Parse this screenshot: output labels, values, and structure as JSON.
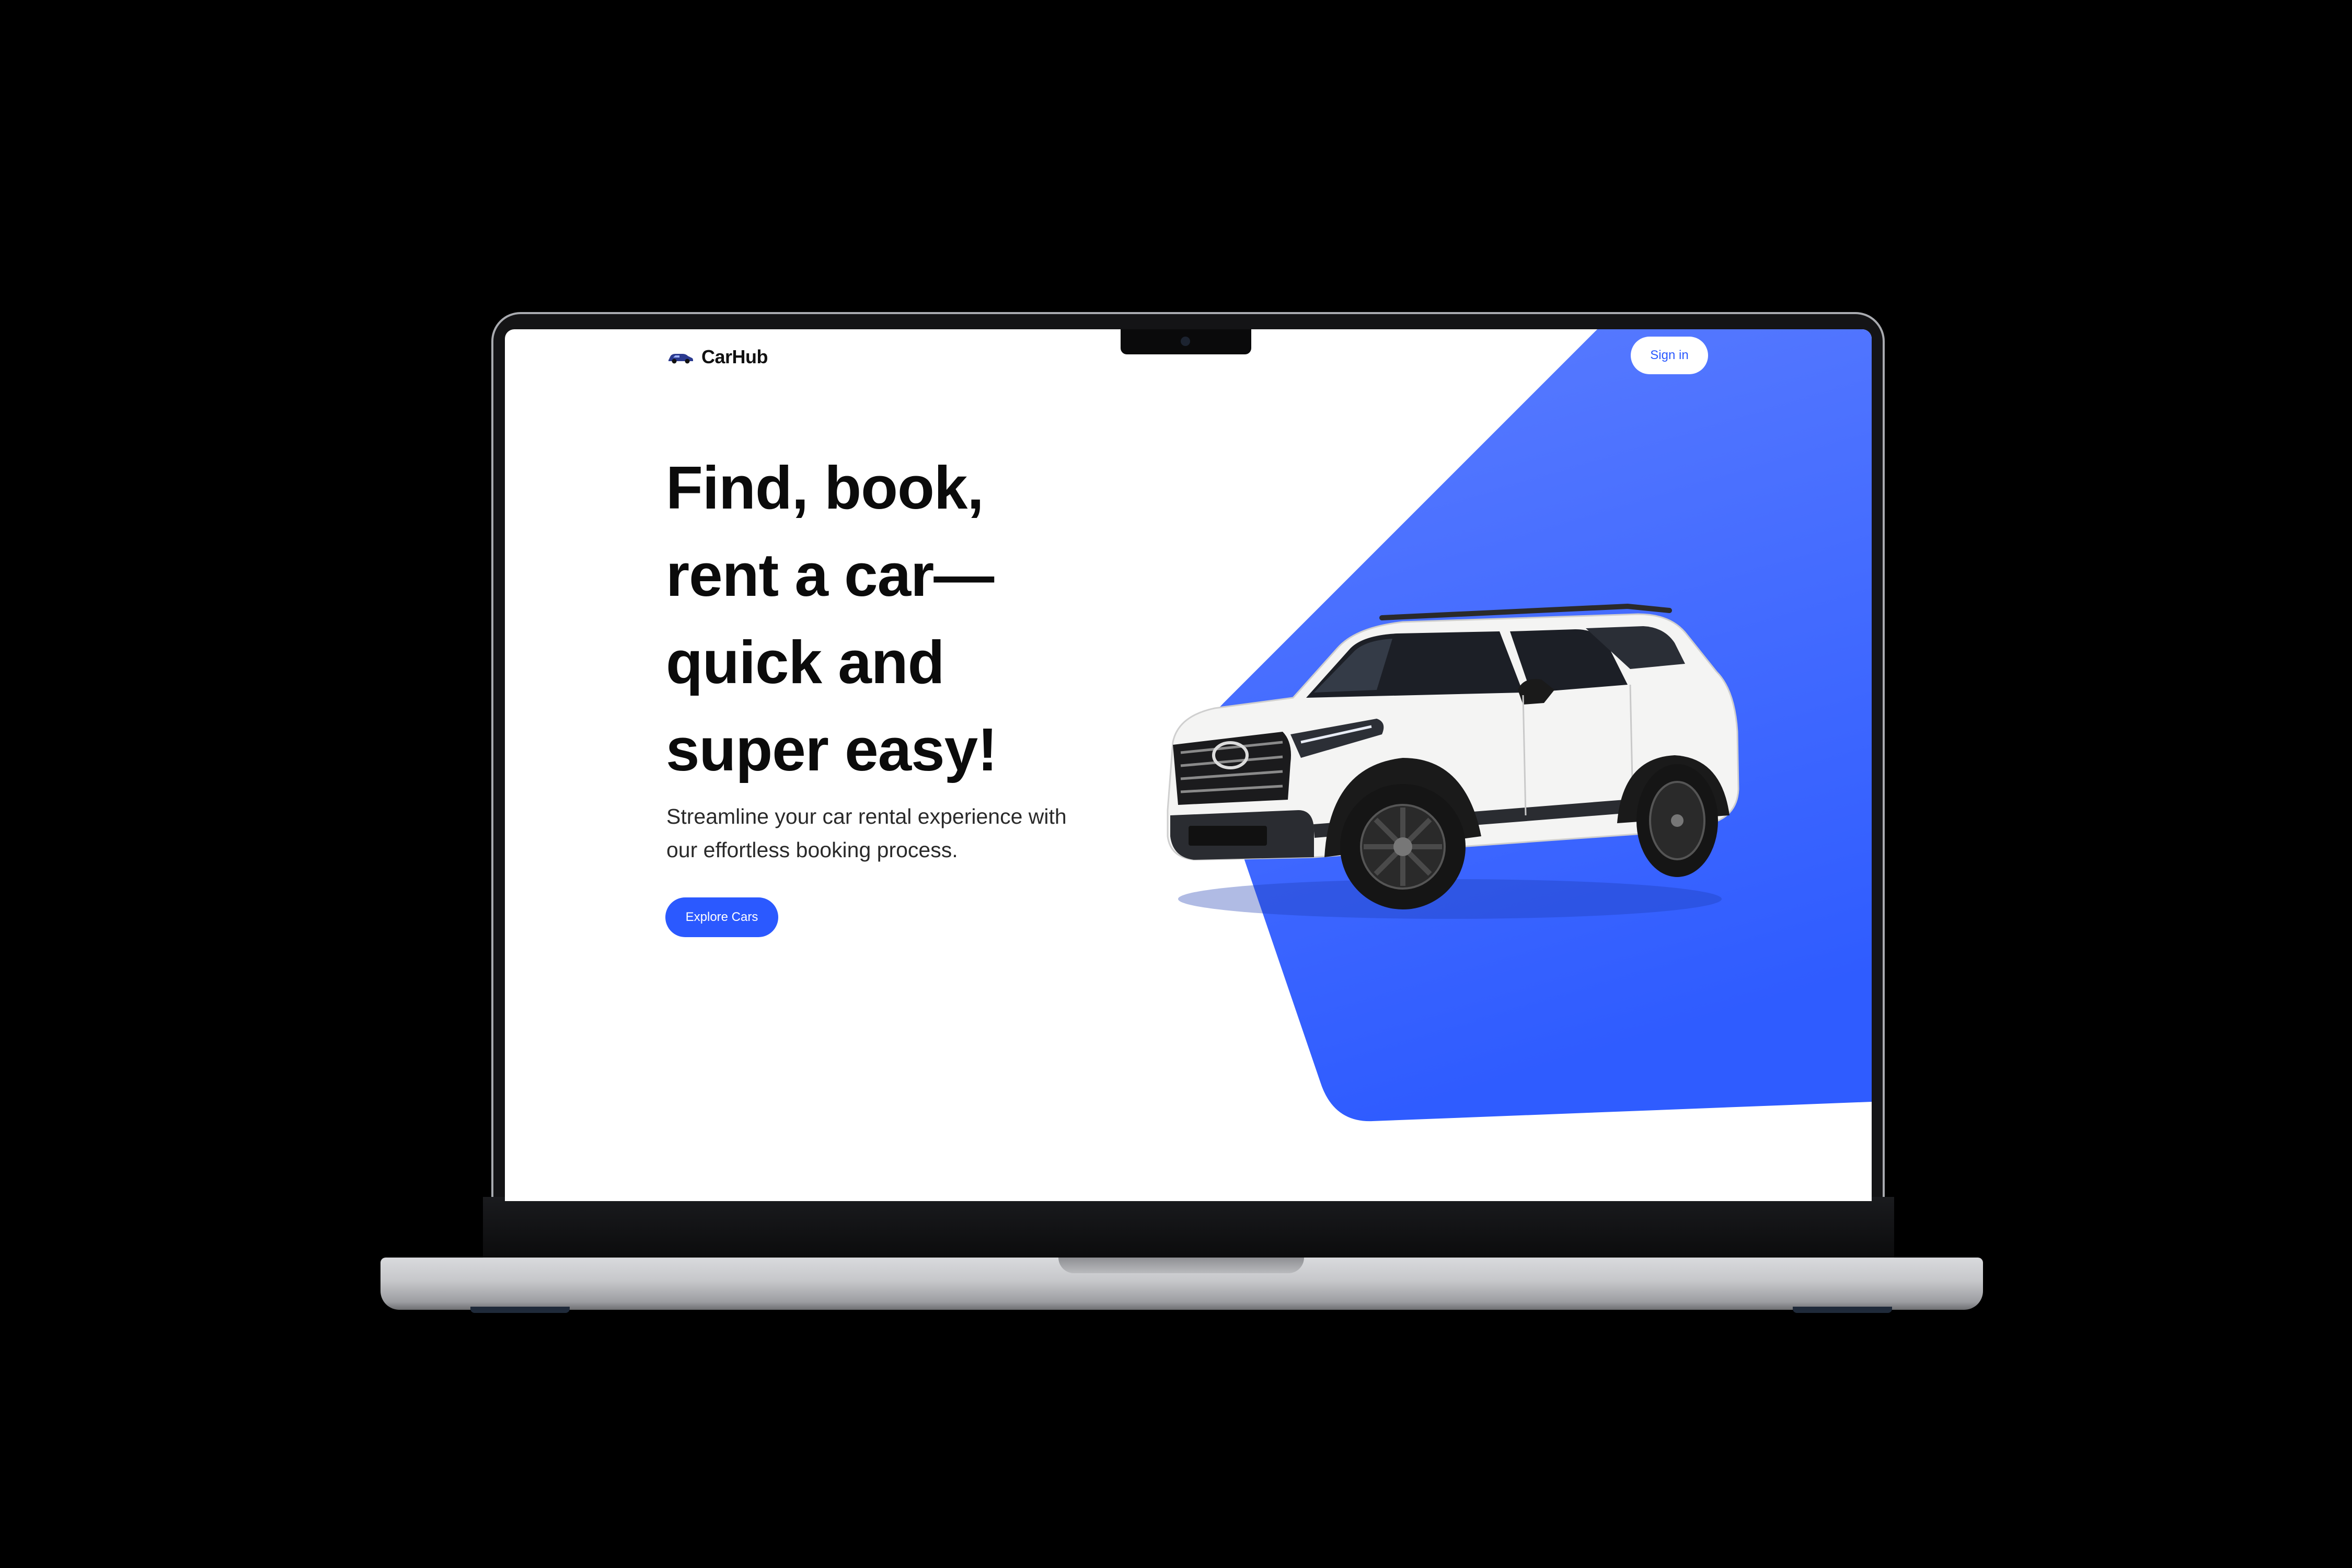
{
  "app": {
    "brand": "CarHub",
    "brand_icon": "car-icon",
    "accent_color": "#2b59ff"
  },
  "nav": {
    "signin_label": "Sign in"
  },
  "hero": {
    "headline_lines": [
      "Find, book,",
      "rent a car—",
      "quick and",
      "super easy!"
    ],
    "subtitle_lines": [
      "Streamline your car rental experience with",
      "our effortless booking process."
    ],
    "cta_label": "Explore Cars",
    "image": "suv-car-image"
  }
}
